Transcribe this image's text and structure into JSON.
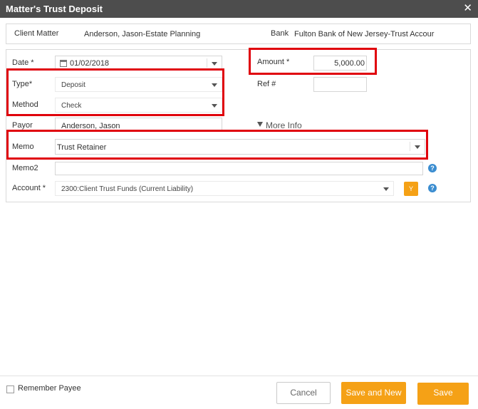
{
  "window": {
    "title": "Matter's Trust Deposit",
    "close_glyph": "✕"
  },
  "info": {
    "client_matter_label": "Client Matter",
    "client_matter_value": "Anderson, Jason-Estate Planning",
    "bank_label": "Bank",
    "bank_value": "Fulton Bank of New Jersey-Trust Accour"
  },
  "form": {
    "date_label": "Date *",
    "date_value": "01/02/2018",
    "amount_label": "Amount *",
    "amount_value": "5,000.00",
    "type_label": "Type*",
    "type_value": "Deposit",
    "ref_label": "Ref #",
    "ref_value": "",
    "method_label": "Method",
    "method_value": "Check",
    "payor_label": "Payor",
    "payor_value": "Anderson, Jason",
    "more_info_label": "More Info",
    "memo_label": "Memo",
    "memo_value": "Trust Retainer",
    "memo2_label": "Memo2",
    "memo2_value": "",
    "account_label": "Account *",
    "account_value": "2300:Client Trust Funds (Current Liability)",
    "account_button_label": "Y",
    "help_glyph": "?"
  },
  "footer": {
    "remember_payee_label": "Remember Payee",
    "remember_payee_checked": false,
    "cancel_label": "Cancel",
    "save_and_new_label": "Save and New",
    "save_label": "Save"
  },
  "colors": {
    "titlebar": "#4d4d4d",
    "accent": "#f5a116",
    "highlight": "#e0000b",
    "help": "#3b8dd0"
  }
}
